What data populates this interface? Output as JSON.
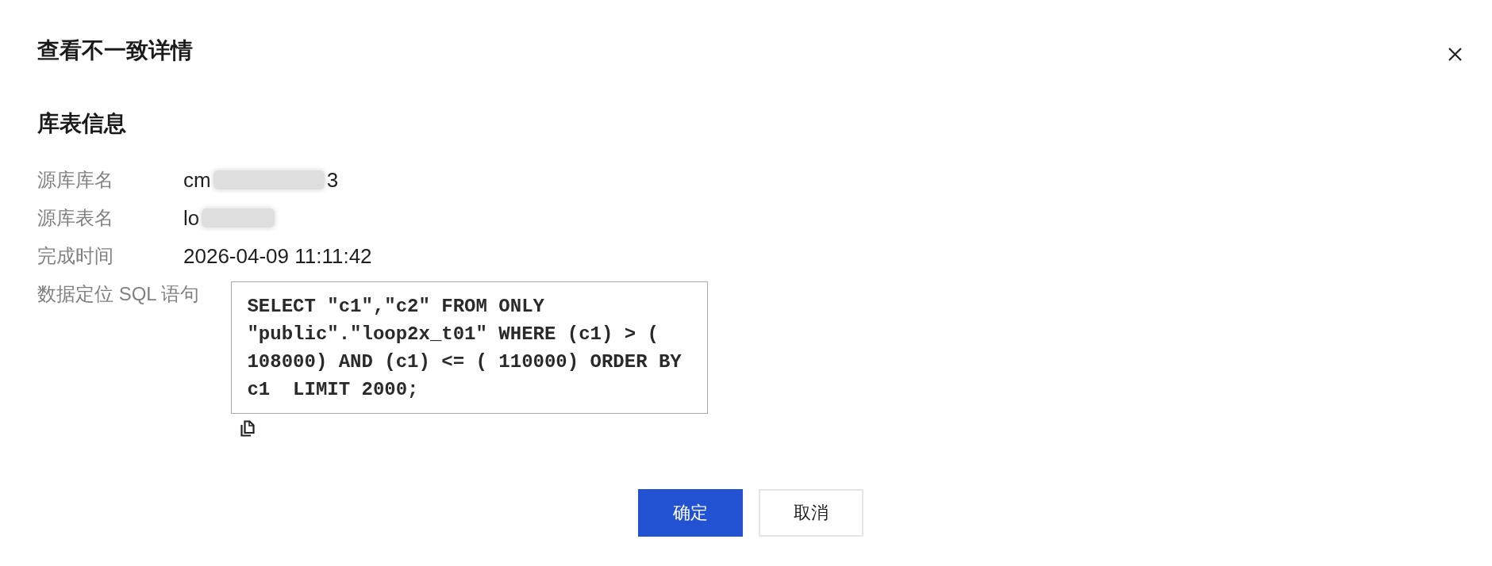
{
  "dialog": {
    "title": "查看不一致详情"
  },
  "section": {
    "title": "库表信息"
  },
  "rows": [
    {
      "kind": "text",
      "label": "源库库名",
      "value": "cm",
      "redacted": true,
      "value_after": "3"
    },
    {
      "kind": "text",
      "label": "源库表名",
      "value": "lo",
      "redacted": true
    },
    {
      "kind": "text",
      "label": "完成时间",
      "value": "2026-04-09 11:11:42"
    },
    {
      "kind": "code",
      "label": "数据定位 SQL 语句",
      "code": "SELECT \"c1\",\"c2\" FROM ONLY \"public\".\"loop2x_t01\" WHERE (c1) > ( 108000) AND (c1) <= ( 110000) ORDER BY c1  LIMIT 2000;"
    }
  ],
  "buttons": [
    {
      "label": "确定",
      "primary": true
    },
    {
      "label": "取消",
      "primary": false
    }
  ]
}
